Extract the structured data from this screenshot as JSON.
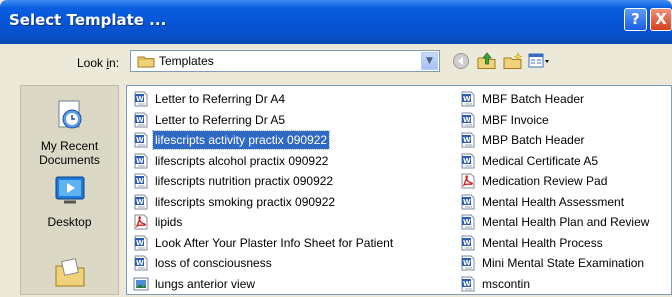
{
  "window": {
    "title": "Select Template ...",
    "help_label": "?",
    "close_label": "X"
  },
  "lookin": {
    "label_prefix": "Look ",
    "label_key": "i",
    "label_suffix": "n:",
    "folder": "Templates",
    "dropdown_arrow": "▼"
  },
  "toolbar": {
    "icons": [
      "back-icon",
      "up-folder-icon",
      "new-folder-icon",
      "view-menu-icon"
    ]
  },
  "places": [
    {
      "label": "My Recent Documents",
      "icon": "recent-documents-icon"
    },
    {
      "label": "Desktop",
      "icon": "desktop-icon"
    },
    {
      "label": "",
      "icon": "my-documents-icon"
    }
  ],
  "files_col1": [
    {
      "name": "Letter to Referring Dr A4",
      "type": "word"
    },
    {
      "name": "Letter to Referring Dr A5",
      "type": "word"
    },
    {
      "name": "lifescripts activity practix 090922",
      "type": "word",
      "selected": true
    },
    {
      "name": "lifescripts alcohol practix 090922",
      "type": "word"
    },
    {
      "name": "lifescripts nutrition practix 090922",
      "type": "word"
    },
    {
      "name": "lifescripts smoking practix 090922",
      "type": "word"
    },
    {
      "name": "lipids",
      "type": "pdf"
    },
    {
      "name": "Look After Your Plaster Info Sheet for Patient",
      "type": "word"
    },
    {
      "name": "loss of consciousness",
      "type": "word"
    },
    {
      "name": "lungs anterior view",
      "type": "image"
    }
  ],
  "files_col2": [
    {
      "name": "MBF Batch Header",
      "type": "word"
    },
    {
      "name": "MBF Invoice",
      "type": "word"
    },
    {
      "name": "MBP Batch Header",
      "type": "word"
    },
    {
      "name": "Medical Certificate A5",
      "type": "word"
    },
    {
      "name": "Medication Review Pad",
      "type": "pdf"
    },
    {
      "name": "Mental Health Assessment",
      "type": "word"
    },
    {
      "name": "Mental Health Plan and Review",
      "type": "word"
    },
    {
      "name": "Mental Health Process",
      "type": "word"
    },
    {
      "name": "Mini Mental State Examination",
      "type": "word"
    },
    {
      "name": "mscontin",
      "type": "word"
    }
  ],
  "colors": {
    "titlebar": "#0654d6",
    "selection": "#316ac5",
    "dialog_bg": "#ece9d8"
  }
}
